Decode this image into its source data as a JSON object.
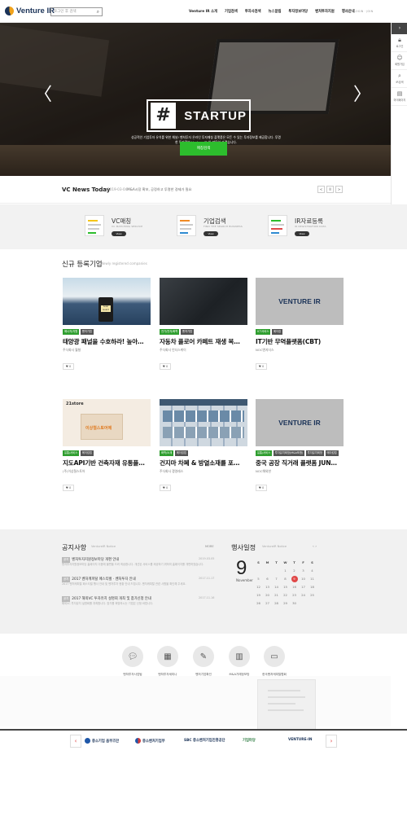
{
  "header": {
    "logo": "Venture IR",
    "search_placeholder": "로그인 후 검색",
    "nav": [
      "Venture IR 소개",
      "기업검색",
      "투자사검색",
      "뉴스알림",
      "투자정보마당",
      "벤처투자지원",
      "행사안내"
    ],
    "util": "HOME · LOGIN · JOIN"
  },
  "quickbar": {
    "items": [
      {
        "label": "로그인",
        "icon": "lock-icon"
      },
      {
        "label": "회원가입",
        "icon": "person-icon"
      },
      {
        "label": "IR검색",
        "icon": "search-icon"
      },
      {
        "label": "마이페이지",
        "icon": "document-icon"
      }
    ]
  },
  "hero": {
    "hash": "#",
    "word": "STARTUP",
    "desc": "성공적인 기업투자 유치를 위한 채널! 벤처투자 온라인 투자매칭 플랫폼은 모든 수 있는 투자정보를 제공합니다. 투명한 투자정보 Venture IR 이 만들어 가겠습니다.",
    "cta": "매칭검색"
  },
  "news": {
    "title": "VC News Today",
    "date": "2019-03-04",
    "text": "M&A시장 확보, 공정하고 투명한 경제가 필요",
    "controls": [
      "<",
      "II",
      ">"
    ]
  },
  "services": [
    {
      "title": "VC매칭",
      "sub": "VC MATCHING SERVICE",
      "btn": "View"
    },
    {
      "title": "기업검색",
      "sub": "FIND THE SEARCH BUSINESS",
      "btn": "View"
    },
    {
      "title": "IR자료등록",
      "sub": "IR REGISTRATION DATA",
      "btn": "View"
    }
  ],
  "new_companies": {
    "title": "신규 등록기업",
    "sub": "Newly registered companies",
    "cards": [
      {
        "tags": [
          {
            "t": "에너지/자원",
            "c": "g"
          },
          {
            "t": "벤처기업",
            "c": "d"
          }
        ],
        "name": "태양광 패널을 수호하라! 높아…",
        "company": "주식회사 월형",
        "like": "♥ 0",
        "img": "solar"
      },
      {
        "tags": [
          {
            "t": "전기/전자/화학",
            "c": "g"
          },
          {
            "t": "벤처기업",
            "c": "d"
          }
        ],
        "name": "자동차 플로어 카페트 재생 복…",
        "company": "주식회사 언더스케이",
        "like": "♥ 0",
        "img": "dark"
      },
      {
        "tags": [
          {
            "t": "ICT서비스",
            "c": "g"
          },
          {
            "t": "메이킹",
            "c": "d"
          }
        ],
        "name": "IT기반 무역플랫폼(CBT)",
        "company": "NOC앤지더스",
        "like": "♥ 0",
        "img": "grey"
      },
      {
        "tags": [
          {
            "t": "유통/서비스",
            "c": "g"
          },
          {
            "t": "메이킹업",
            "c": "d"
          }
        ],
        "name": "지도API기반 건축자재 유통플…",
        "company": "(주)이상철스토어",
        "like": "♥ 0",
        "img": "store"
      },
      {
        "tags": [
          {
            "t": "화학/소재",
            "c": "g"
          },
          {
            "t": "메이킹업",
            "c": "d"
          }
        ],
        "name": "건지마 차폐 & 방열소재를 포…",
        "company": "주식회사 쟁영레스",
        "like": "♥ 0",
        "img": "grid"
      },
      {
        "tags": [
          {
            "t": "유통/서비스",
            "c": "g"
          },
          {
            "t": "투자유치희망(M&A포함)",
            "c": "d"
          },
          {
            "t": "투자유치희망",
            "c": "d"
          },
          {
            "t": "메이킹업",
            "c": "d"
          }
        ],
        "name": "중국 공장 직거래 플랫폼 JUN…",
        "company": "NOC해외한",
        "like": "♥ 0",
        "img": "grey"
      }
    ],
    "grey_logo": "VENTURE IR",
    "store_brand": "21store",
    "store_banner": "이상철스토어에",
    "solar_label": "Solar Guard"
  },
  "notice": {
    "title": "공지사항",
    "sub": "VentureIR Notice",
    "more": "MORE",
    "items": [
      {
        "badge": "공지",
        "title": "벤처투자지원정보마당 개편 안내",
        "date": "2019.03.05",
        "excerpt": "벤처투자지원정보마당 홈페이지 이용에 불편을 드려 죄송합니다. 개선된 서비스를 제공하기 위하여 홈페이지를 개편하였습니다."
      },
      {
        "badge": "공지",
        "title": "2017 벤처캐피탈 페스티벌 · 벤처투자 안내",
        "date": "2017.11.17",
        "excerpt": "2017 벤처캐피탈 페스티벌 행사 안내 및 벤처투자 현황 안내 드립니다. 벤처캐피탈 관련 사항을 확인해 주세요."
      },
      {
        "badge": "공지",
        "title": "2017 해외VC 투자유치 설명회 개최 및 참가신청 안내",
        "date": "2017.11.16",
        "excerpt": "해외VC 투자유치 설명회를 개최합니다. 참가를 희망하시는 기업은 신청 바랍니다."
      }
    ]
  },
  "calendar": {
    "title": "행사일정",
    "sub": "VentureIR Notice",
    "nav": "‹ ›",
    "day": "9",
    "month": "November",
    "headers": [
      "S",
      "M",
      "T",
      "W",
      "T",
      "F",
      "S"
    ],
    "rows": [
      [
        "",
        "",
        "",
        "1",
        "2",
        "3",
        "4"
      ],
      [
        "5",
        "6",
        "7",
        "8",
        "9",
        "10",
        "11"
      ],
      [
        "12",
        "13",
        "14",
        "15",
        "16",
        "17",
        "18"
      ],
      [
        "19",
        "20",
        "21",
        "22",
        "23",
        "24",
        "25"
      ],
      [
        "26",
        "27",
        "28",
        "29",
        "30",
        "",
        ""
      ]
    ],
    "today_row": 1,
    "today_col": 4
  },
  "quicklinks": [
    {
      "label": "벤처투자사업팀",
      "icon": "chat-icon"
    },
    {
      "label": "벤처투자세미나",
      "icon": "presentation-icon"
    },
    {
      "label": "벤처기업확인",
      "icon": "edit-icon"
    },
    {
      "label": "M&A거래정보망",
      "icon": "clipboard-icon"
    },
    {
      "label": "한국벤처캐피탈협회",
      "icon": "monitor-icon"
    }
  ],
  "partners": [
    {
      "name": "중소기업 옴부즈만",
      "color": "#1f57a8"
    },
    {
      "name": "중소벤처기업부",
      "color": "#d23a3a"
    },
    {
      "name": "SBC 중소벤처기업진흥공단",
      "color": "#1f57a8"
    },
    {
      "name": "기업마당",
      "color": "#2b7a3f"
    },
    {
      "name": "VENTURE-IN",
      "color": "#1b3358"
    }
  ],
  "partner_prev": "‹",
  "partner_next": "›"
}
